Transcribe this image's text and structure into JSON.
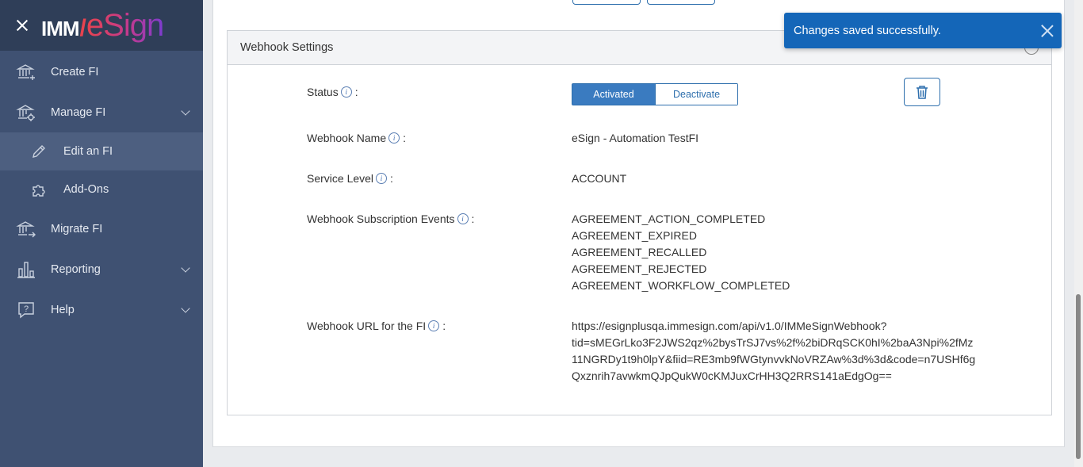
{
  "app": {
    "logo_text": "IMM/eSign",
    "logo_imm": "IMM",
    "logo_esign": "eSign"
  },
  "sidebar": {
    "items": [
      {
        "label": "Create FI",
        "icon": "bank-plus-icon"
      },
      {
        "label": "Manage FI",
        "icon": "bank-gear-icon",
        "expanded": true
      },
      {
        "label": "Edit an FI",
        "icon": "pencil-icon",
        "active": true
      },
      {
        "label": "Add-Ons",
        "icon": "puzzle-icon"
      },
      {
        "label": "Migrate FI",
        "icon": "bank-arrow-icon"
      },
      {
        "label": "Reporting",
        "icon": "bar-chart-icon"
      },
      {
        "label": "Help",
        "icon": "help-bubble-icon"
      }
    ]
  },
  "panel": {
    "title": "Webhook Settings",
    "status": {
      "label": "Status",
      "activated": "Activated",
      "deactivate": "Deactivate",
      "selected": "Activated"
    },
    "webhook_name": {
      "label": "Webhook Name",
      "value": "eSign - Automation TestFI"
    },
    "service_level": {
      "label": "Service Level",
      "value": "ACCOUNT"
    },
    "subscription_events": {
      "label": "Webhook Subscription Events",
      "values": [
        "AGREEMENT_ACTION_COMPLETED",
        "AGREEMENT_EXPIRED",
        "AGREEMENT_RECALLED",
        "AGREEMENT_REJECTED",
        "AGREEMENT_WORKFLOW_COMPLETED"
      ]
    },
    "webhook_url": {
      "label": "Webhook URL for the FI",
      "lines": [
        "https://esignplusqa.immesign.com/api/v1.0/IMMeSignWebhook?",
        "tid=sMEGrLko3F2JWS2qz%2bysTrSJ7vs%2f%2biDRqSCK0hI%2baA3Npi%2fMz",
        "11NGRDy1t9h0lpY&fiid=RE3mb9fWGtynvvkNoVRZAw%3d%3d&code=n7USHf6g",
        "Qxznrih7avwkmQJpQukW0cKMJuxCrHH3Q2RRS141aEdgOg=="
      ]
    },
    "separator": ":"
  },
  "toast": {
    "message": "Changes saved successfully."
  },
  "colors": {
    "sidebar_bg": "#3f5172",
    "sidebar_header": "#2f3e58",
    "accent": "#2e6fad",
    "toast_bg": "#1466b8"
  }
}
